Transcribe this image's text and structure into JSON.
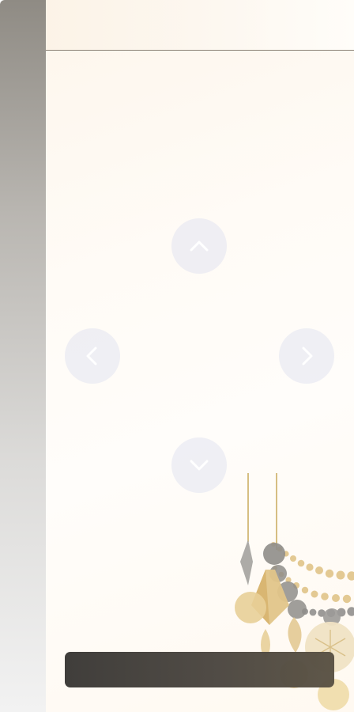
{
  "app": {
    "accent_color": "#e2e4f0",
    "sidebar_color": "#8f8b84",
    "bar_color": "#3a3835"
  },
  "navigation": {
    "up_icon": "chevron-up-icon",
    "left_icon": "chevron-left-icon",
    "right_icon": "chevron-right-icon",
    "down_icon": "chevron-down-icon"
  },
  "decoration": {
    "name": "christmas-ornaments",
    "colors": [
      "#e3c993",
      "#9c9a98",
      "#f0e3c4"
    ]
  }
}
